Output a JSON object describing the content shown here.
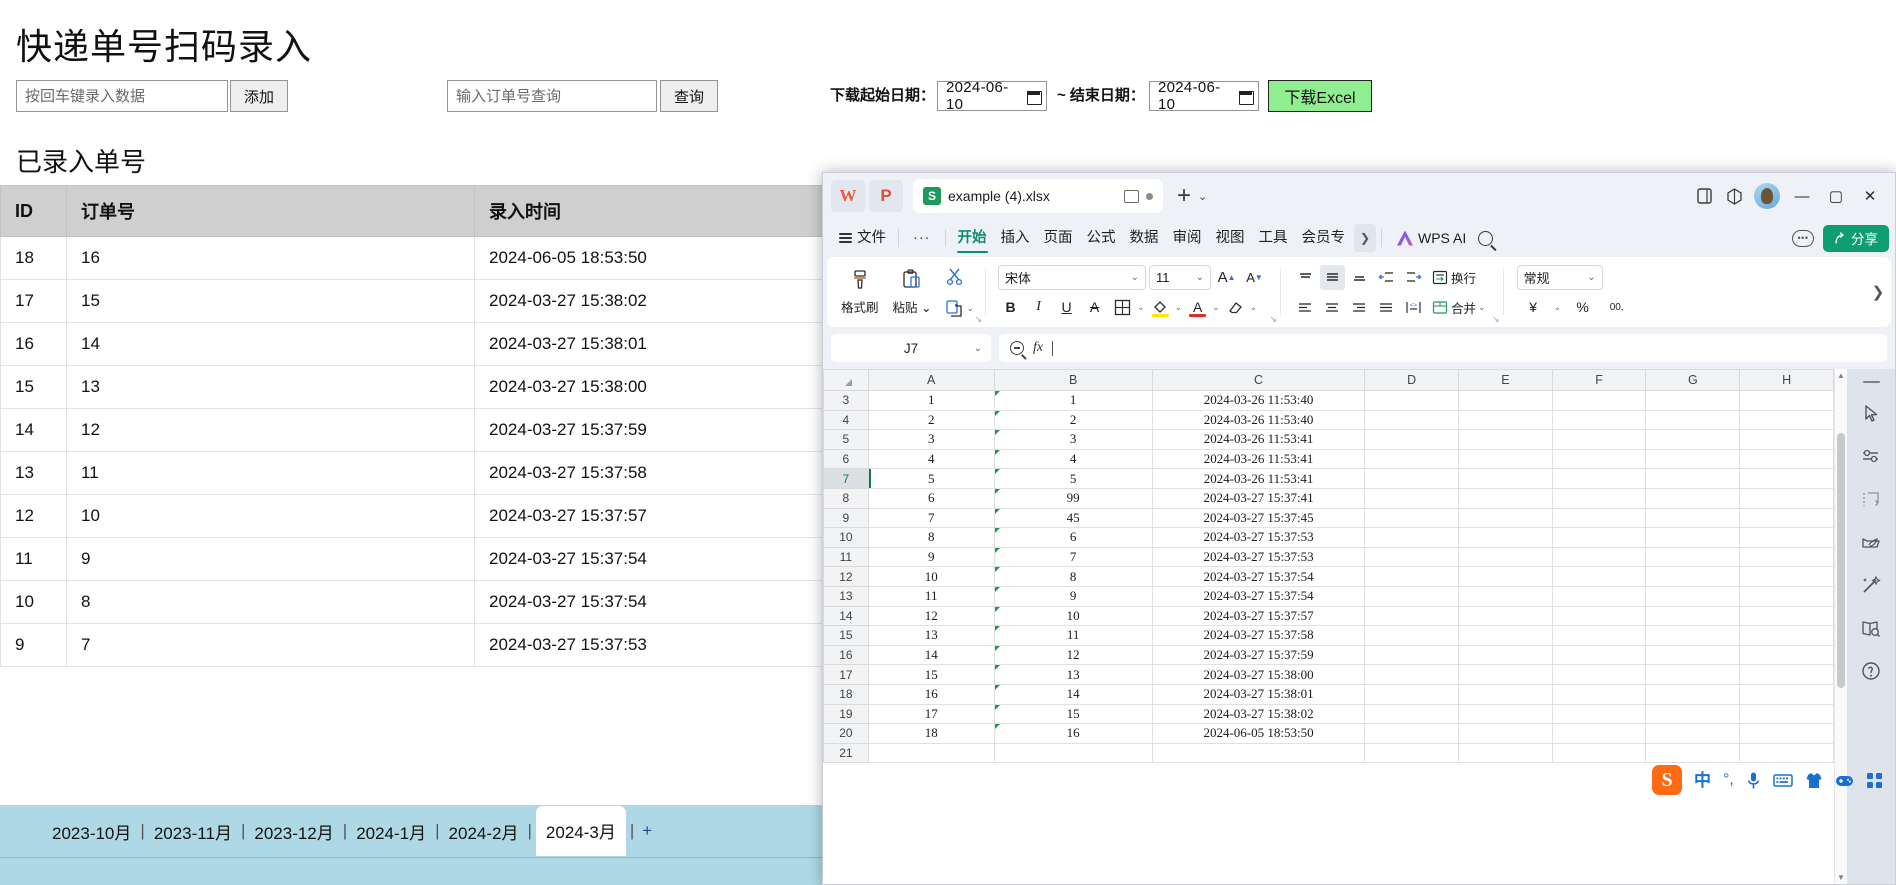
{
  "webapp": {
    "title": "快递单号扫码录入",
    "scan_input_placeholder": "按回车键录入数据",
    "add_button": "添加",
    "query_input_placeholder": "输入订单号查询",
    "query_button": "查询",
    "start_date_label": "下载起始日期：",
    "start_date_value": "2024-06-10",
    "range_sep_label": "~ 结束日期：",
    "end_date_value": "2024-06-10",
    "download_button": "下载Excel",
    "download_button_color": "#90ee90",
    "section_title": "已录入单号",
    "table": {
      "headers": [
        "ID",
        "订单号",
        "录入时间"
      ],
      "rows": [
        [
          "18",
          "16",
          "2024-06-05 18:53:50"
        ],
        [
          "17",
          "15",
          "2024-03-27 15:38:02"
        ],
        [
          "16",
          "14",
          "2024-03-27 15:38:01"
        ],
        [
          "15",
          "13",
          "2024-03-27 15:38:00"
        ],
        [
          "14",
          "12",
          "2024-03-27 15:37:59"
        ],
        [
          "13",
          "11",
          "2024-03-27 15:37:58"
        ],
        [
          "12",
          "10",
          "2024-03-27 15:37:57"
        ],
        [
          "11",
          "9",
          "2024-03-27 15:37:54"
        ],
        [
          "10",
          "8",
          "2024-03-27 15:37:54"
        ],
        [
          "9",
          "7",
          "2024-03-27 15:37:53"
        ]
      ]
    },
    "sheet_tabs": {
      "items": [
        "2023-10月",
        "2023-11月",
        "2023-12月",
        "2024-1月",
        "2024-2月",
        "2024-3月"
      ],
      "active_index": 5,
      "add_label": "+",
      "separator": "|",
      "strip_color": "#aed8e6"
    }
  },
  "wps": {
    "titlebar": {
      "app_icon_w": "W",
      "app_icon_pdf": "P",
      "doc_badge": "S",
      "doc_name": "example (4).xlsx",
      "new_tab": "+",
      "tab_menu_caret": "⌄",
      "minimize": "—",
      "maximize": "▢",
      "close": "✕"
    },
    "menu": {
      "file": "文件",
      "more_dots": "···",
      "items": [
        "开始",
        "插入",
        "页面",
        "公式",
        "数据",
        "审阅",
        "视图",
        "工具",
        "会员专"
      ],
      "active_index": 0,
      "overflow_caret": "❯",
      "ai_label": "WPS AI",
      "share_label": "分享",
      "share_color": "#0f9e72",
      "accent_color": "#0d8f6f"
    },
    "ribbon": {
      "format_painter": "格式刷",
      "paste": "粘贴",
      "font_name": "宋体",
      "font_size": "11",
      "grow_font": "A",
      "shrink_font": "A",
      "bold": "B",
      "italic": "I",
      "underline": "U",
      "strike": "A",
      "border": "⊞",
      "fill_color": "◌",
      "font_color": "A",
      "clear_format": "◇",
      "wrap_text": "换行",
      "merge_cells": "合并",
      "number_format": "常规",
      "currency": "¥",
      "percent": "%",
      "comma": "00,",
      "expand": "❯",
      "dialog_launcher": "↘"
    },
    "formula_bar": {
      "name_box": "J7",
      "caret": "⌄",
      "fx_label": "fx",
      "formula_value": ""
    },
    "grid": {
      "columns": [
        "A",
        "B",
        "C",
        "D",
        "E",
        "F",
        "G",
        "H"
      ],
      "row_numbers": [
        "3",
        "4",
        "5",
        "6",
        "7",
        "8",
        "9",
        "10",
        "11",
        "12",
        "13",
        "14",
        "15",
        "16",
        "17",
        "18",
        "19",
        "20",
        "21"
      ],
      "selected_row": "7",
      "selected_cell": "J7",
      "rows": [
        {
          "n": "3",
          "a": "1",
          "b": "1",
          "c": "2024-03-26 11:53:40"
        },
        {
          "n": "4",
          "a": "2",
          "b": "2",
          "c": "2024-03-26 11:53:40"
        },
        {
          "n": "5",
          "a": "3",
          "b": "3",
          "c": "2024-03-26 11:53:41"
        },
        {
          "n": "6",
          "a": "4",
          "b": "4",
          "c": "2024-03-26 11:53:41"
        },
        {
          "n": "7",
          "a": "5",
          "b": "5",
          "c": "2024-03-26 11:53:41"
        },
        {
          "n": "8",
          "a": "6",
          "b": "99",
          "c": "2024-03-27 15:37:41"
        },
        {
          "n": "9",
          "a": "7",
          "b": "45",
          "c": "2024-03-27 15:37:45"
        },
        {
          "n": "10",
          "a": "8",
          "b": "6",
          "c": "2024-03-27 15:37:53"
        },
        {
          "n": "11",
          "a": "9",
          "b": "7",
          "c": "2024-03-27 15:37:53"
        },
        {
          "n": "12",
          "a": "10",
          "b": "8",
          "c": "2024-03-27 15:37:54"
        },
        {
          "n": "13",
          "a": "11",
          "b": "9",
          "c": "2024-03-27 15:37:54"
        },
        {
          "n": "14",
          "a": "12",
          "b": "10",
          "c": "2024-03-27 15:37:57"
        },
        {
          "n": "15",
          "a": "13",
          "b": "11",
          "c": "2024-03-27 15:37:58"
        },
        {
          "n": "16",
          "a": "14",
          "b": "12",
          "c": "2024-03-27 15:37:59"
        },
        {
          "n": "17",
          "a": "15",
          "b": "13",
          "c": "2024-03-27 15:38:00"
        },
        {
          "n": "18",
          "a": "16",
          "b": "14",
          "c": "2024-03-27 15:38:01"
        },
        {
          "n": "19",
          "a": "17",
          "b": "15",
          "c": "2024-03-27 15:38:02"
        },
        {
          "n": "20",
          "a": "18",
          "b": "16",
          "c": "2024-06-05 18:53:50"
        },
        {
          "n": "21",
          "a": "",
          "b": "",
          "c": ""
        }
      ]
    },
    "right_rail": [
      "cursor-icon",
      "settings-icon",
      "wrap-icon",
      "eco-icon",
      "magic-icon",
      "docsearch-icon",
      "help-icon"
    ]
  },
  "ime": {
    "logo": "S",
    "language": "中",
    "punctuation": "°,",
    "icons": [
      "mic-icon",
      "keyboard-icon",
      "skin-icon",
      "game-icon",
      "apps-icon"
    ]
  }
}
